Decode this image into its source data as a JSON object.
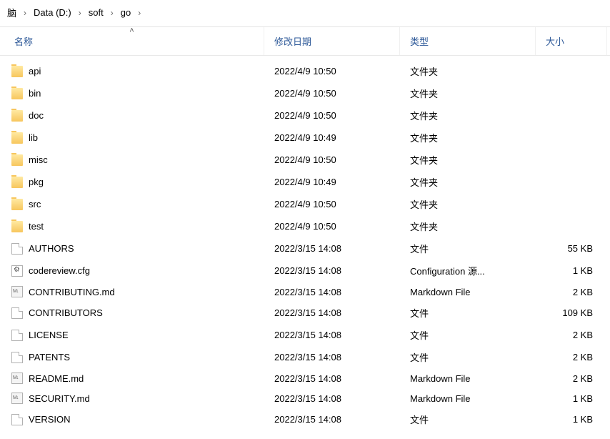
{
  "breadcrumb": {
    "items": [
      {
        "label": "脑"
      },
      {
        "label": "Data (D:)"
      },
      {
        "label": "soft"
      },
      {
        "label": "go"
      }
    ]
  },
  "columns": {
    "name": "名称",
    "modified": "修改日期",
    "type": "类型",
    "size": "大小",
    "sorted_by": "name",
    "sort_dir": "asc"
  },
  "entries": [
    {
      "name": "api",
      "modified": "2022/4/9 10:50",
      "type": "文件夹",
      "size": "",
      "icon": "folder"
    },
    {
      "name": "bin",
      "modified": "2022/4/9 10:50",
      "type": "文件夹",
      "size": "",
      "icon": "folder"
    },
    {
      "name": "doc",
      "modified": "2022/4/9 10:50",
      "type": "文件夹",
      "size": "",
      "icon": "folder"
    },
    {
      "name": "lib",
      "modified": "2022/4/9 10:49",
      "type": "文件夹",
      "size": "",
      "icon": "folder"
    },
    {
      "name": "misc",
      "modified": "2022/4/9 10:50",
      "type": "文件夹",
      "size": "",
      "icon": "folder"
    },
    {
      "name": "pkg",
      "modified": "2022/4/9 10:49",
      "type": "文件夹",
      "size": "",
      "icon": "folder"
    },
    {
      "name": "src",
      "modified": "2022/4/9 10:50",
      "type": "文件夹",
      "size": "",
      "icon": "folder"
    },
    {
      "name": "test",
      "modified": "2022/4/9 10:50",
      "type": "文件夹",
      "size": "",
      "icon": "folder"
    },
    {
      "name": "AUTHORS",
      "modified": "2022/3/15 14:08",
      "type": "文件",
      "size": "55 KB",
      "icon": "file"
    },
    {
      "name": "codereview.cfg",
      "modified": "2022/3/15 14:08",
      "type": "Configuration 源...",
      "size": "1 KB",
      "icon": "cfg"
    },
    {
      "name": "CONTRIBUTING.md",
      "modified": "2022/3/15 14:08",
      "type": "Markdown File",
      "size": "2 KB",
      "icon": "md"
    },
    {
      "name": "CONTRIBUTORS",
      "modified": "2022/3/15 14:08",
      "type": "文件",
      "size": "109 KB",
      "icon": "file"
    },
    {
      "name": "LICENSE",
      "modified": "2022/3/15 14:08",
      "type": "文件",
      "size": "2 KB",
      "icon": "file"
    },
    {
      "name": "PATENTS",
      "modified": "2022/3/15 14:08",
      "type": "文件",
      "size": "2 KB",
      "icon": "file"
    },
    {
      "name": "README.md",
      "modified": "2022/3/15 14:08",
      "type": "Markdown File",
      "size": "2 KB",
      "icon": "md"
    },
    {
      "name": "SECURITY.md",
      "modified": "2022/3/15 14:08",
      "type": "Markdown File",
      "size": "1 KB",
      "icon": "md"
    },
    {
      "name": "VERSION",
      "modified": "2022/3/15 14:08",
      "type": "文件",
      "size": "1 KB",
      "icon": "file"
    }
  ]
}
